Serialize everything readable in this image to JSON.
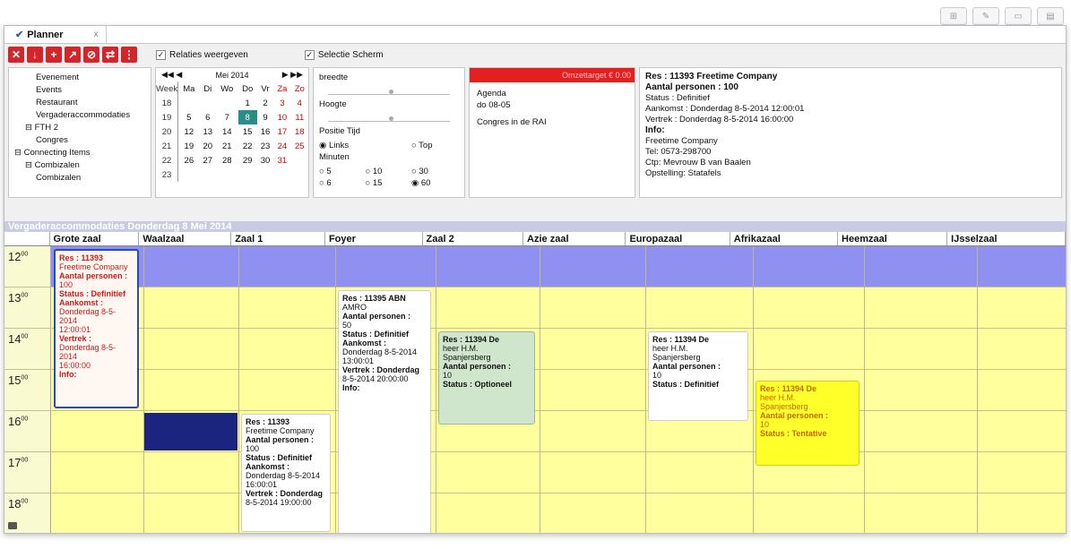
{
  "window": {
    "tab_title": "Planner",
    "tab_close": "x"
  },
  "toolbar": {
    "buttons": [
      "✕",
      "↓",
      "+",
      "↗",
      "⊘",
      "⇄",
      "⋮"
    ],
    "relaties": "Relaties weergeven",
    "selectie": "Selectie Scherm"
  },
  "tree": {
    "items": [
      {
        "label": "Evenement",
        "indent": 2
      },
      {
        "label": "Events",
        "indent": 2
      },
      {
        "label": "Restaurant",
        "indent": 2
      },
      {
        "label": "Vergaderaccommodaties",
        "indent": 2
      },
      {
        "label": "⊟ FTH 2",
        "indent": 1
      },
      {
        "label": "Congres",
        "indent": 2
      },
      {
        "label": "⊟ Connecting Items",
        "indent": 0
      },
      {
        "label": "⊟ Combizalen",
        "indent": 1
      },
      {
        "label": "Combizalen",
        "indent": 2
      }
    ]
  },
  "calendar": {
    "month": "Mei 2014",
    "days": [
      "Week",
      "Ma",
      "Di",
      "Wo",
      "Do",
      "Vr",
      "Za",
      "Zo"
    ],
    "weeks": [
      [
        "18",
        "",
        "",
        "",
        "1",
        "2",
        "3",
        "4"
      ],
      [
        "19",
        "5",
        "6",
        "7",
        "8",
        "9",
        "10",
        "11"
      ],
      [
        "20",
        "12",
        "13",
        "14",
        "15",
        "16",
        "17",
        "18"
      ],
      [
        "21",
        "19",
        "20",
        "21",
        "22",
        "23",
        "24",
        "25"
      ],
      [
        "22",
        "26",
        "27",
        "28",
        "29",
        "30",
        "31",
        ""
      ],
      [
        "23",
        "",
        "",
        "",
        "",
        "",
        "",
        ""
      ]
    ],
    "selected": "8"
  },
  "settings": {
    "breedte": "breedte",
    "hoogte": "Hoogte",
    "positie": "Positie Tijd",
    "links": "Links",
    "top": "Top",
    "minuten": "Minuten",
    "minutes": [
      "5",
      "10",
      "30",
      "6",
      "15",
      "60"
    ]
  },
  "target": {
    "bar_text": "Omzettarget € 0.00",
    "agenda": "Agenda",
    "date": "do 08-05",
    "item": "Congres in de RAI"
  },
  "info": {
    "res": "Res : 11393 Freetime Company",
    "personen": "Aantal personen : 100",
    "status": "Status : Definitief",
    "aankomst": "Aankomst : Donderdag 8-5-2014 12:00:01",
    "vertrek": "Vertrek : Donderdag 8-5-2014 16:00:00",
    "info_label": "Info:",
    "l1": "Freetime Company",
    "l2": "Tel: 0573-298700",
    "l3": "Ctp: Mevrouw B van Baalen",
    "l4": "Opstelling: Statafels"
  },
  "grid": {
    "title": "Vergaderaccommodaties Donderdag 8 Mei 2014",
    "columns": [
      "Grote zaal",
      "Waalzaal",
      "Zaal 1",
      "Foyer",
      "Zaal 2",
      "Azie zaal",
      "Europazaal",
      "Afrikazaal",
      "Heemzaal",
      "IJsselzaal"
    ],
    "hours": [
      "12",
      "13",
      "14",
      "15",
      "16",
      "17",
      "18"
    ],
    "minute_sup": "00"
  },
  "events": [
    {
      "id": "e1",
      "lines": [
        "Res : 11393",
        "Freetime Company",
        "Aantal personen :",
        "100",
        "Status : Definitief",
        "Aankomst :",
        "Donderdag 8-5-2014",
        "12:00:01",
        "Vertrek :",
        "Donderdag 8-5-2014",
        "16:00:00",
        "Info:"
      ]
    },
    {
      "id": "e2",
      "lines": [
        "Res : 11395 ABN",
        "AMRO",
        "Aantal personen :",
        "50",
        "Status : Definitief",
        "Aankomst :",
        "Donderdag 8-5-2014",
        "13:00:01",
        "Vertrek : Donderdag",
        "8-5-2014 20:00:00",
        "Info:"
      ]
    },
    {
      "id": "e3",
      "lines": [
        "Res : 11394 De",
        "heer H.M.",
        "Spanjersberg",
        "Aantal personen :",
        "10",
        "Status : Optioneel"
      ]
    },
    {
      "id": "e4",
      "lines": [
        "Res : 11394 De",
        "heer H.M.",
        "Spanjersberg",
        "Aantal personen :",
        "10",
        "Status : Definitief"
      ]
    },
    {
      "id": "e5",
      "lines": [
        "Res : 11394 De",
        "heer H.M.",
        "Spanjersberg",
        "Aantal personen :",
        "10",
        "Status : Tentative"
      ]
    },
    {
      "id": "e6",
      "lines": [
        "Res : 11393",
        "Freetime Company",
        "Aantal personen :",
        "100",
        "Status : Definitief",
        "Aankomst :",
        "Donderdag 8-5-2014",
        "16:00:01",
        "Vertrek : Donderdag",
        "8-5-2014 19:00:00"
      ]
    }
  ],
  "top_controls": [
    "⊞",
    "✎",
    "▭",
    "▤"
  ]
}
